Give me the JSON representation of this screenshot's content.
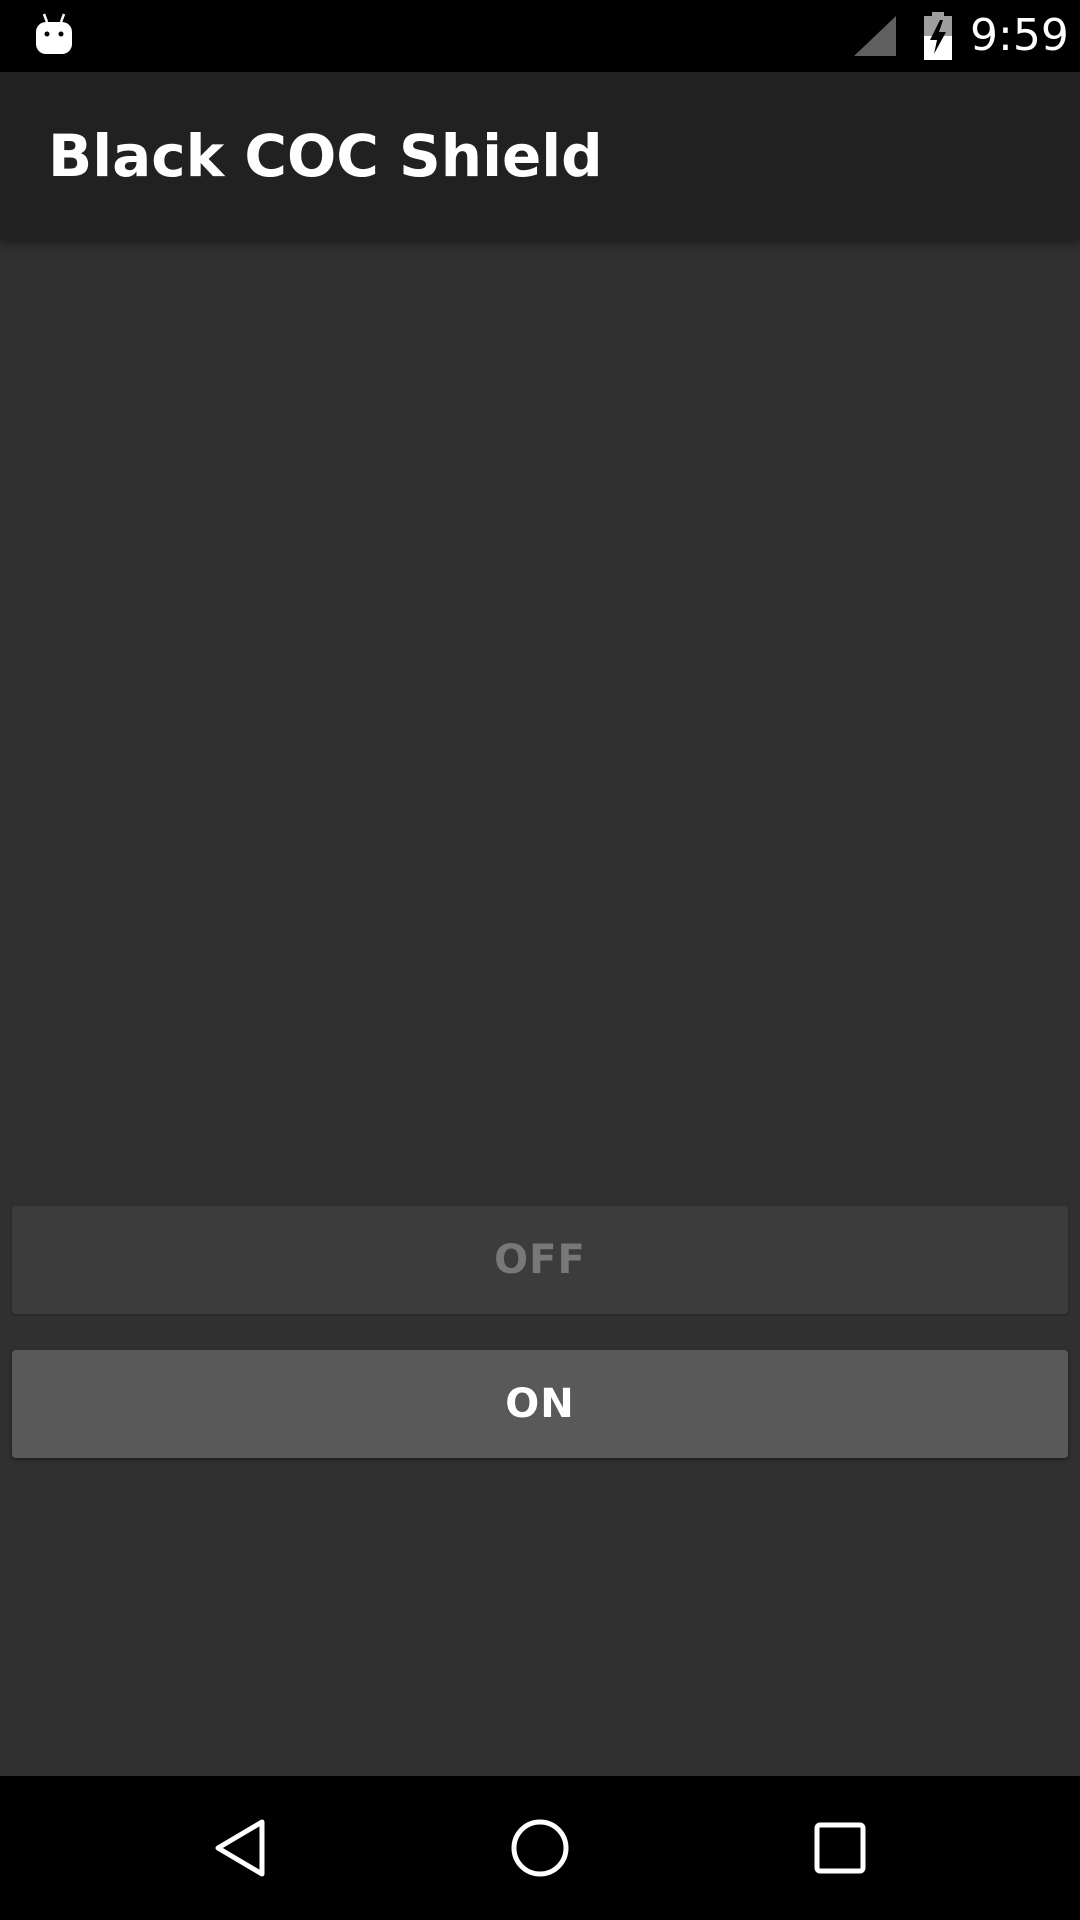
{
  "status_bar": {
    "time": "9:59",
    "notification_icon": "android-icon",
    "signal_icon": "cell-signal-icon",
    "battery_icon": "battery-charging-icon"
  },
  "app_bar": {
    "title": "Black COC Shield"
  },
  "buttons": {
    "off_label": "OFF",
    "on_label": "ON"
  },
  "nav_bar": {
    "back_icon": "back-icon",
    "home_icon": "home-icon",
    "recents_icon": "recents-icon"
  },
  "colors": {
    "background": "#303030",
    "app_bar": "#212121",
    "button_disabled": "#3c3c3c",
    "button_enabled": "#595959"
  }
}
